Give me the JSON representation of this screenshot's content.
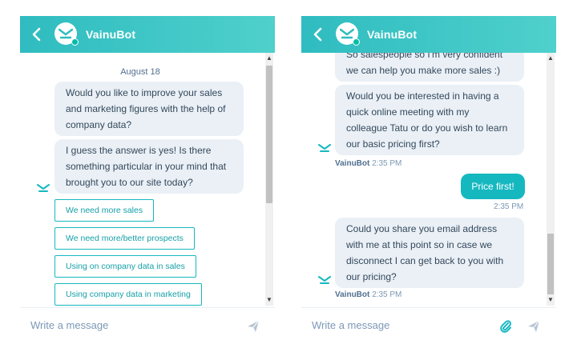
{
  "bot": {
    "name": "VainuBot"
  },
  "colors": {
    "accent": "#16b8c0",
    "header_start": "#2fbcc0",
    "header_end": "#4fd0cc",
    "bubble_bg": "#eaf0f6"
  },
  "left_chat": {
    "date": "August 18",
    "messages": [
      "Would you like to improve your sales and marketing figures with the help of company data?",
      "I guess the answer is yes! Is there something particular in your mind that brought you to our site today?"
    ],
    "message_lines": [
      [
        "Would you like to improve your sales",
        "and marketing figures with the help of",
        "company data?"
      ],
      [
        "I guess the answer is yes! Is there",
        "something particular in your mind that",
        "brought you to our site today?"
      ]
    ],
    "quick_replies": [
      "We need more sales",
      "We need more/better prospects",
      "Using on company data in sales",
      "Using company data in marketing"
    ]
  },
  "right_chat": {
    "partial_message_lines": [
      "So salespeople so I'm very confident",
      "we can help you make more sales :)"
    ],
    "message_lines_1": [
      "Would you be interested in having a",
      "quick online meeting with my",
      "colleague Tatu or do you wish to learn",
      "our basic pricing first?"
    ],
    "meta_1": {
      "sender": "VainuBot",
      "time": "2:35 PM"
    },
    "user_reply": "Price first!",
    "user_reply_time": "2:35 PM",
    "message_lines_2": [
      "Could you share you email address",
      "with me at this point so in case we",
      "disconnect I can get back to you with",
      "our pricing?"
    ],
    "meta_2": {
      "sender": "VainuBot",
      "time": "2:35 PM"
    }
  },
  "composer": {
    "placeholder": "Write a message"
  },
  "icons": {
    "back": "chevron-left-icon",
    "avatar": "vainubot-logo-icon",
    "send": "paper-plane-icon",
    "attach": "paperclip-icon"
  }
}
